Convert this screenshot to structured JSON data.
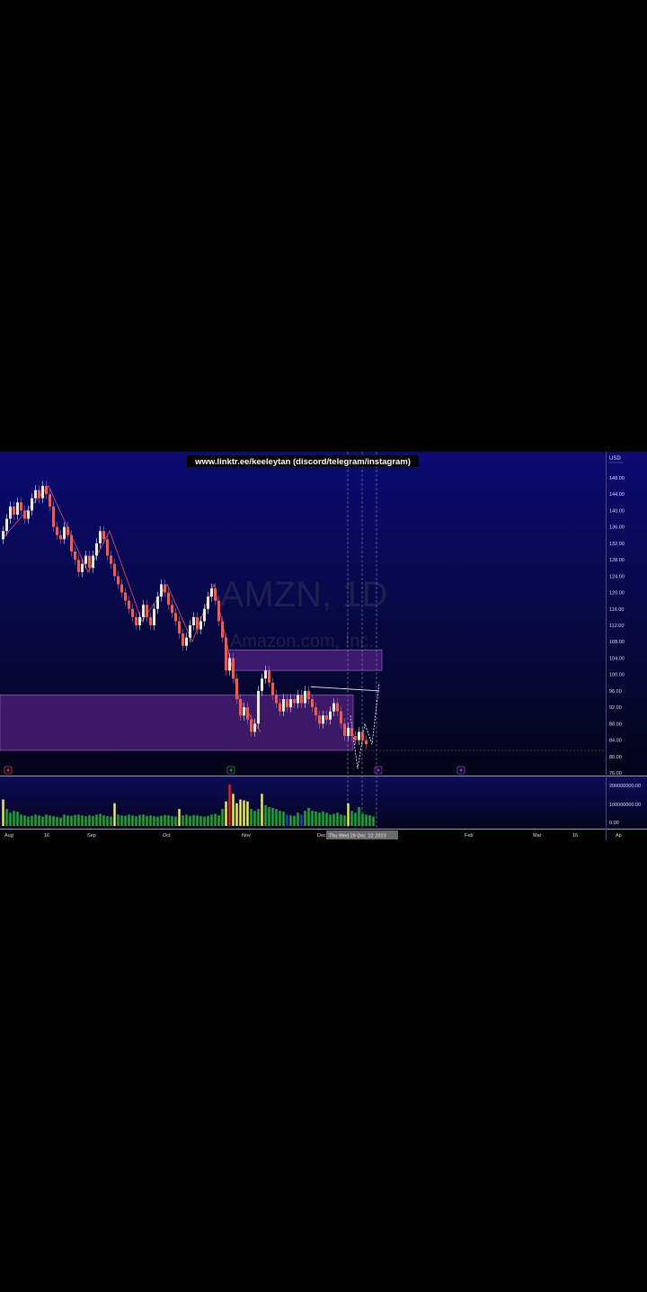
{
  "banner": {
    "text": "www.linktr.ee/keeleytan (discord/telegram/instagram)"
  },
  "watermark": {
    "symbol": "AMZN, 1D",
    "company": "Amazon.com, Inc."
  },
  "price_axis": {
    "currency": "USD",
    "ticks": [
      "148.00",
      "144.00",
      "140.00",
      "136.00",
      "132.00",
      "128.00",
      "124.00",
      "120.00",
      "116.00",
      "112.00",
      "108.00",
      "104.00",
      "100.00",
      "96.00",
      "92.00",
      "88.00",
      "84.00",
      "80.00",
      "76.00"
    ]
  },
  "volume_axis": {
    "ticks": [
      "200000000.00",
      "100000000.00",
      "0.00"
    ]
  },
  "time_axis": {
    "labels": [
      {
        "text": "Aug",
        "i": 0
      },
      {
        "text": "16",
        "i": 11
      },
      {
        "text": "Sep",
        "i": 23
      },
      {
        "text": "Oct",
        "i": 44
      },
      {
        "text": "Nov",
        "i": 66
      },
      {
        "text": "Dec",
        "i": 87
      },
      {
        "text": "Feb",
        "i": 128
      },
      {
        "text": "Mar",
        "i": 147
      },
      {
        "text": "16",
        "i": 158
      },
      {
        "text": "Ap",
        "i": 170
      }
    ],
    "crosshair_label": "Thu   Wed 29 Dec '22  2023"
  },
  "colors": {
    "up": "#e8e8e8",
    "down": "#e06060",
    "vol_green": "#22a83a",
    "vol_yellow": "#f0f060",
    "vol_red": "#e02020",
    "zone": "#6a2a9a",
    "bg_top": "#0a0a6a",
    "bg_bottom": "#05051a"
  },
  "chart_data": {
    "type": "candlestick",
    "title": "AMZN, 1D",
    "subtitle": "Amazon.com, Inc.",
    "ylabel": "USD",
    "ylim": [
      74,
      150
    ],
    "zones": [
      {
        "y_top": 95,
        "y_bottom": 81.5,
        "i_start": 0,
        "i_end": 97
      },
      {
        "y_top": 106,
        "y_bottom": 101,
        "i_start": 63,
        "i_end": 105
      }
    ],
    "open_close": [
      [
        133,
        135
      ],
      [
        135,
        138
      ],
      [
        138,
        141
      ],
      [
        141,
        139
      ],
      [
        139,
        142
      ],
      [
        142,
        140
      ],
      [
        140,
        138
      ],
      [
        138,
        140
      ],
      [
        140,
        143
      ],
      [
        143,
        145
      ],
      [
        145,
        143
      ],
      [
        143,
        146
      ],
      [
        146,
        144
      ],
      [
        144,
        141
      ],
      [
        141,
        136
      ],
      [
        136,
        134
      ],
      [
        134,
        133
      ],
      [
        133,
        136
      ],
      [
        136,
        134
      ],
      [
        134,
        130
      ],
      [
        130,
        128
      ],
      [
        128,
        125
      ],
      [
        125,
        127
      ],
      [
        127,
        129
      ],
      [
        129,
        126
      ],
      [
        126,
        129
      ],
      [
        129,
        132
      ],
      [
        132,
        135
      ],
      [
        135,
        133
      ],
      [
        133,
        129
      ],
      [
        129,
        127
      ],
      [
        127,
        124
      ],
      [
        124,
        122
      ],
      [
        122,
        120
      ],
      [
        120,
        118
      ],
      [
        118,
        116
      ],
      [
        116,
        114
      ],
      [
        114,
        112
      ],
      [
        112,
        114
      ],
      [
        114,
        117
      ],
      [
        117,
        114
      ],
      [
        114,
        112
      ],
      [
        112,
        116
      ],
      [
        116,
        119
      ],
      [
        119,
        122
      ],
      [
        122,
        120
      ],
      [
        120,
        117
      ],
      [
        117,
        115
      ],
      [
        115,
        113
      ],
      [
        113,
        110
      ],
      [
        110,
        107
      ],
      [
        107,
        109
      ],
      [
        109,
        112
      ],
      [
        112,
        114
      ],
      [
        114,
        111
      ],
      [
        111,
        113
      ],
      [
        113,
        116
      ],
      [
        116,
        119
      ],
      [
        119,
        121
      ],
      [
        121,
        118
      ],
      [
        118,
        113
      ],
      [
        113,
        109
      ],
      [
        109,
        101
      ],
      [
        101,
        104
      ],
      [
        104,
        99
      ],
      [
        99,
        94
      ],
      [
        94,
        90
      ],
      [
        90,
        92
      ],
      [
        92,
        89
      ],
      [
        89,
        86
      ],
      [
        86,
        88
      ],
      [
        88,
        96
      ],
      [
        96,
        99
      ],
      [
        99,
        101
      ],
      [
        101,
        98
      ],
      [
        98,
        95
      ],
      [
        95,
        93
      ],
      [
        93,
        91
      ],
      [
        91,
        94
      ],
      [
        94,
        92
      ],
      [
        92,
        94
      ],
      [
        94,
        93
      ],
      [
        93,
        95
      ],
      [
        95,
        93
      ],
      [
        93,
        96
      ],
      [
        96,
        94
      ],
      [
        94,
        92
      ],
      [
        92,
        90
      ],
      [
        90,
        88
      ],
      [
        88,
        90
      ],
      [
        90,
        89
      ],
      [
        89,
        91
      ],
      [
        91,
        93
      ],
      [
        93,
        91
      ],
      [
        91,
        88
      ],
      [
        88,
        85
      ],
      [
        85,
        87
      ],
      [
        87,
        85
      ],
      [
        85,
        84
      ],
      [
        84,
        86
      ],
      [
        86,
        84
      ],
      [
        84,
        83
      ]
    ],
    "volume": [
      [
        70,
        "y"
      ],
      [
        45,
        "g"
      ],
      [
        35,
        "g"
      ],
      [
        40,
        "g"
      ],
      [
        38,
        "g"
      ],
      [
        30,
        "g"
      ],
      [
        28,
        "g"
      ],
      [
        25,
        "g"
      ],
      [
        27,
        "g"
      ],
      [
        30,
        "g"
      ],
      [
        28,
        "g"
      ],
      [
        25,
        "g"
      ],
      [
        30,
        "g"
      ],
      [
        28,
        "g"
      ],
      [
        26,
        "g"
      ],
      [
        24,
        "g"
      ],
      [
        22,
        "g"
      ],
      [
        30,
        "g"
      ],
      [
        28,
        "g"
      ],
      [
        27,
        "g"
      ],
      [
        29,
        "g"
      ],
      [
        30,
        "g"
      ],
      [
        28,
        "g"
      ],
      [
        26,
        "g"
      ],
      [
        28,
        "g"
      ],
      [
        27,
        "g"
      ],
      [
        30,
        "g"
      ],
      [
        32,
        "g"
      ],
      [
        28,
        "g"
      ],
      [
        26,
        "g"
      ],
      [
        25,
        "g"
      ],
      [
        60,
        "y"
      ],
      [
        30,
        "g"
      ],
      [
        28,
        "g"
      ],
      [
        27,
        "g"
      ],
      [
        30,
        "g"
      ],
      [
        28,
        "g"
      ],
      [
        26,
        "g"
      ],
      [
        29,
        "g"
      ],
      [
        30,
        "g"
      ],
      [
        27,
        "g"
      ],
      [
        28,
        "g"
      ],
      [
        26,
        "g"
      ],
      [
        25,
        "g"
      ],
      [
        27,
        "g"
      ],
      [
        29,
        "g"
      ],
      [
        28,
        "g"
      ],
      [
        26,
        "g"
      ],
      [
        25,
        "g"
      ],
      [
        45,
        "y"
      ],
      [
        28,
        "g"
      ],
      [
        30,
        "g"
      ],
      [
        27,
        "g"
      ],
      [
        29,
        "g"
      ],
      [
        28,
        "g"
      ],
      [
        26,
        "g"
      ],
      [
        25,
        "g"
      ],
      [
        27,
        "g"
      ],
      [
        30,
        "g"
      ],
      [
        32,
        "g"
      ],
      [
        28,
        "g"
      ],
      [
        45,
        "g"
      ],
      [
        65,
        "y"
      ],
      [
        110,
        "r"
      ],
      [
        85,
        "y"
      ],
      [
        60,
        "y"
      ],
      [
        70,
        "y"
      ],
      [
        68,
        "y"
      ],
      [
        65,
        "y"
      ],
      [
        45,
        "g"
      ],
      [
        40,
        "g"
      ],
      [
        45,
        "g"
      ],
      [
        85,
        "y"
      ],
      [
        55,
        "g"
      ],
      [
        50,
        "g"
      ],
      [
        48,
        "g"
      ],
      [
        45,
        "g"
      ],
      [
        40,
        "g"
      ],
      [
        38,
        "g"
      ],
      [
        30,
        "b"
      ],
      [
        28,
        "g"
      ],
      [
        27,
        "g"
      ],
      [
        35,
        "g"
      ],
      [
        30,
        "b"
      ],
      [
        40,
        "g"
      ],
      [
        48,
        "g"
      ],
      [
        40,
        "g"
      ],
      [
        38,
        "g"
      ],
      [
        35,
        "g"
      ],
      [
        38,
        "g"
      ],
      [
        35,
        "g"
      ],
      [
        30,
        "g"
      ],
      [
        32,
        "g"
      ],
      [
        35,
        "g"
      ],
      [
        30,
        "g"
      ],
      [
        28,
        "g"
      ],
      [
        60,
        "y"
      ],
      [
        40,
        "g"
      ],
      [
        35,
        "g"
      ],
      [
        50,
        "g"
      ],
      [
        32,
        "g"
      ],
      [
        30,
        "g"
      ],
      [
        28,
        "g"
      ],
      [
        25,
        "g"
      ]
    ]
  }
}
